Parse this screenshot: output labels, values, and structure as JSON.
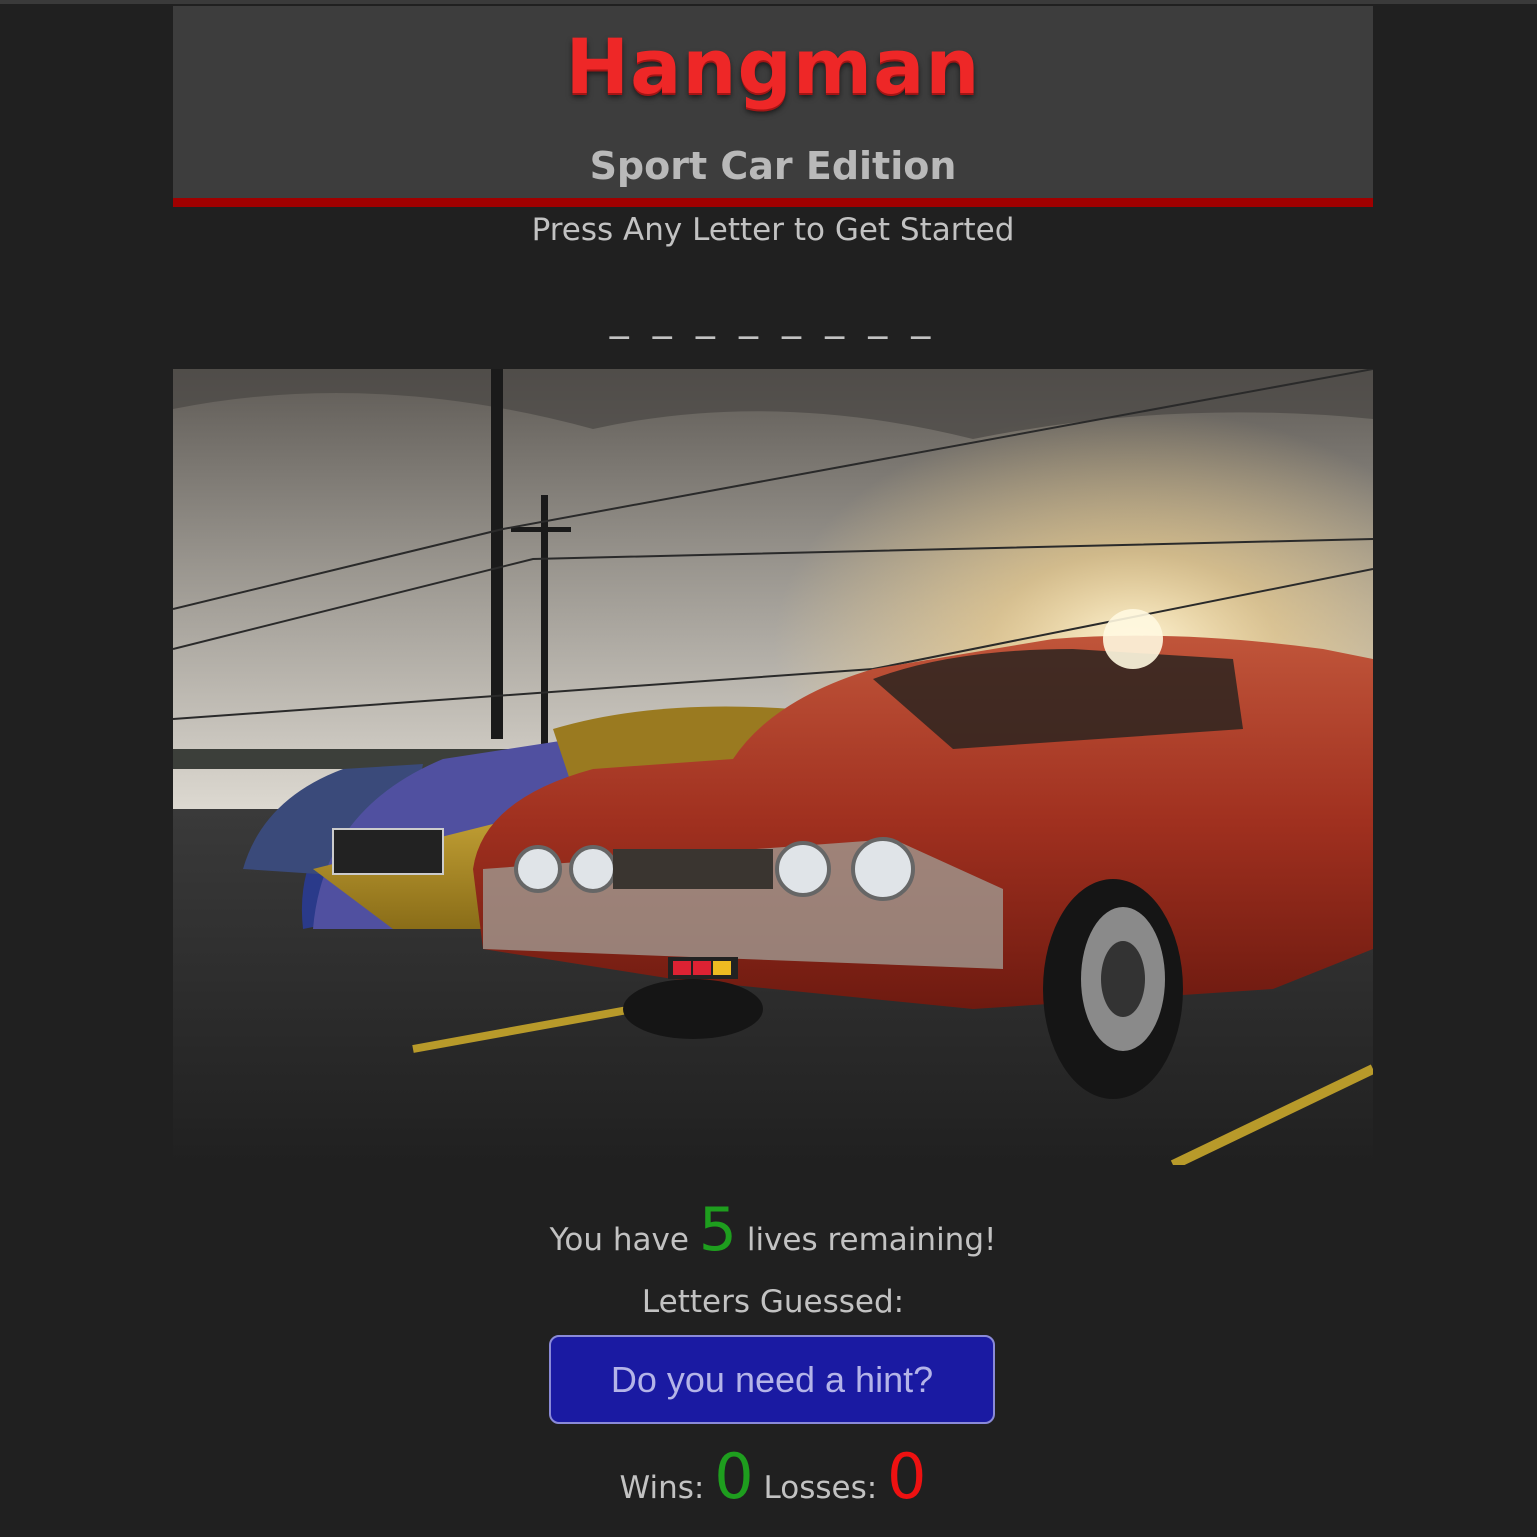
{
  "header": {
    "title": "Hangman",
    "subtitle": "Sport Car Edition"
  },
  "game": {
    "prompt": "Press Any Letter to Get Started",
    "word_display": "_ _ _ _ _ _ _ _",
    "lives_prefix": "You have",
    "lives": "5",
    "lives_suffix": "lives remaining!",
    "letters_guessed_label": "Letters Guessed:",
    "letters_guessed": "",
    "hint_button_label": "Do you need a hint?"
  },
  "score": {
    "wins_label": "Wins:",
    "wins": "0",
    "losses_label": "Losses:",
    "losses": "0"
  },
  "colors": {
    "background": "#202020",
    "header_bg": "#3d3d3d",
    "header_border": "#a00000",
    "title": "#ee2727",
    "lives_number": "#1e9e1e",
    "wins_number": "#1e9e1e",
    "losses_number": "#ee1111",
    "hint_button_bg": "#1a1aa2"
  }
}
